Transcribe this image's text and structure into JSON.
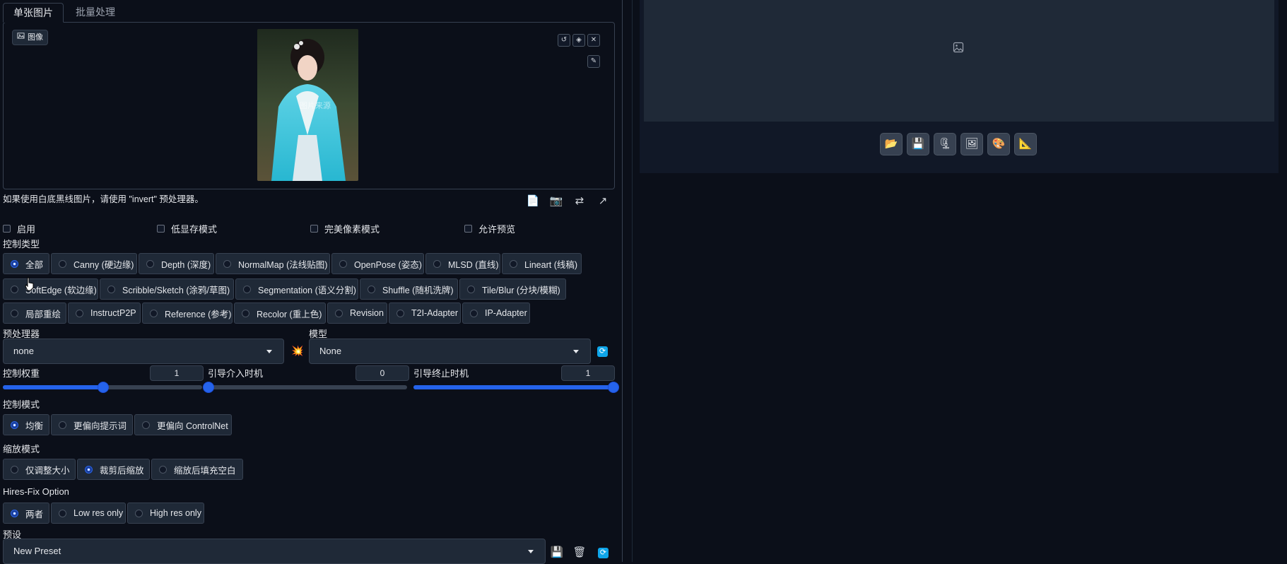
{
  "tabs": [
    "单张图片",
    "批量处理"
  ],
  "image_panel": {
    "label": "图像",
    "watermark": "图片来源"
  },
  "hint": "如果使用白底黑线图片，请使用 \"invert\" 预处理器。",
  "checkboxes": [
    "启用",
    "低显存模式",
    "完美像素模式",
    "允许预览"
  ],
  "control_type": {
    "label": "控制类型",
    "options": [
      "全部",
      "Canny (硬边缘)",
      "Depth (深度)",
      "NormalMap (法线贴图)",
      "OpenPose (姿态)",
      "MLSD (直线)",
      "Lineart (线稿)",
      "SoftEdge (软边缘)",
      "Scribble/Sketch (涂鸦/草图)",
      "Segmentation (语义分割)",
      "Shuffle (随机洗牌)",
      "Tile/Blur (分块/模糊)",
      "局部重绘",
      "InstructP2P",
      "Reference (参考)",
      "Recolor (重上色)",
      "Revision",
      "T2I-Adapter",
      "IP-Adapter"
    ],
    "selected": "全部"
  },
  "preprocessor": {
    "label": "预处理器",
    "value": "none"
  },
  "model": {
    "label": "模型",
    "value": "None"
  },
  "sliders": [
    {
      "label": "控制权重",
      "value": "1",
      "fraction": 0.5
    },
    {
      "label": "引导介入时机",
      "value": "0",
      "fraction": 0.0
    },
    {
      "label": "引导终止时机",
      "value": "1",
      "fraction": 1.0
    }
  ],
  "control_mode": {
    "label": "控制模式",
    "options": [
      "均衡",
      "更偏向提示词",
      "更偏向 ControlNet"
    ],
    "selected": "均衡"
  },
  "resize_mode": {
    "label": "缩放模式",
    "options": [
      "仅调整大小",
      "裁剪后缩放",
      "缩放后填充空白"
    ],
    "selected": "裁剪后缩放"
  },
  "hires_fix": {
    "label": "Hires-Fix Option",
    "options": [
      "两者",
      "Low res only",
      "High res only"
    ],
    "selected": "两者"
  },
  "preset": {
    "label": "预设",
    "value": "New Preset"
  },
  "colors": {
    "accent": "#2563eb",
    "background": "#0b0f19",
    "surface": "#1f2937",
    "border": "#374151"
  }
}
